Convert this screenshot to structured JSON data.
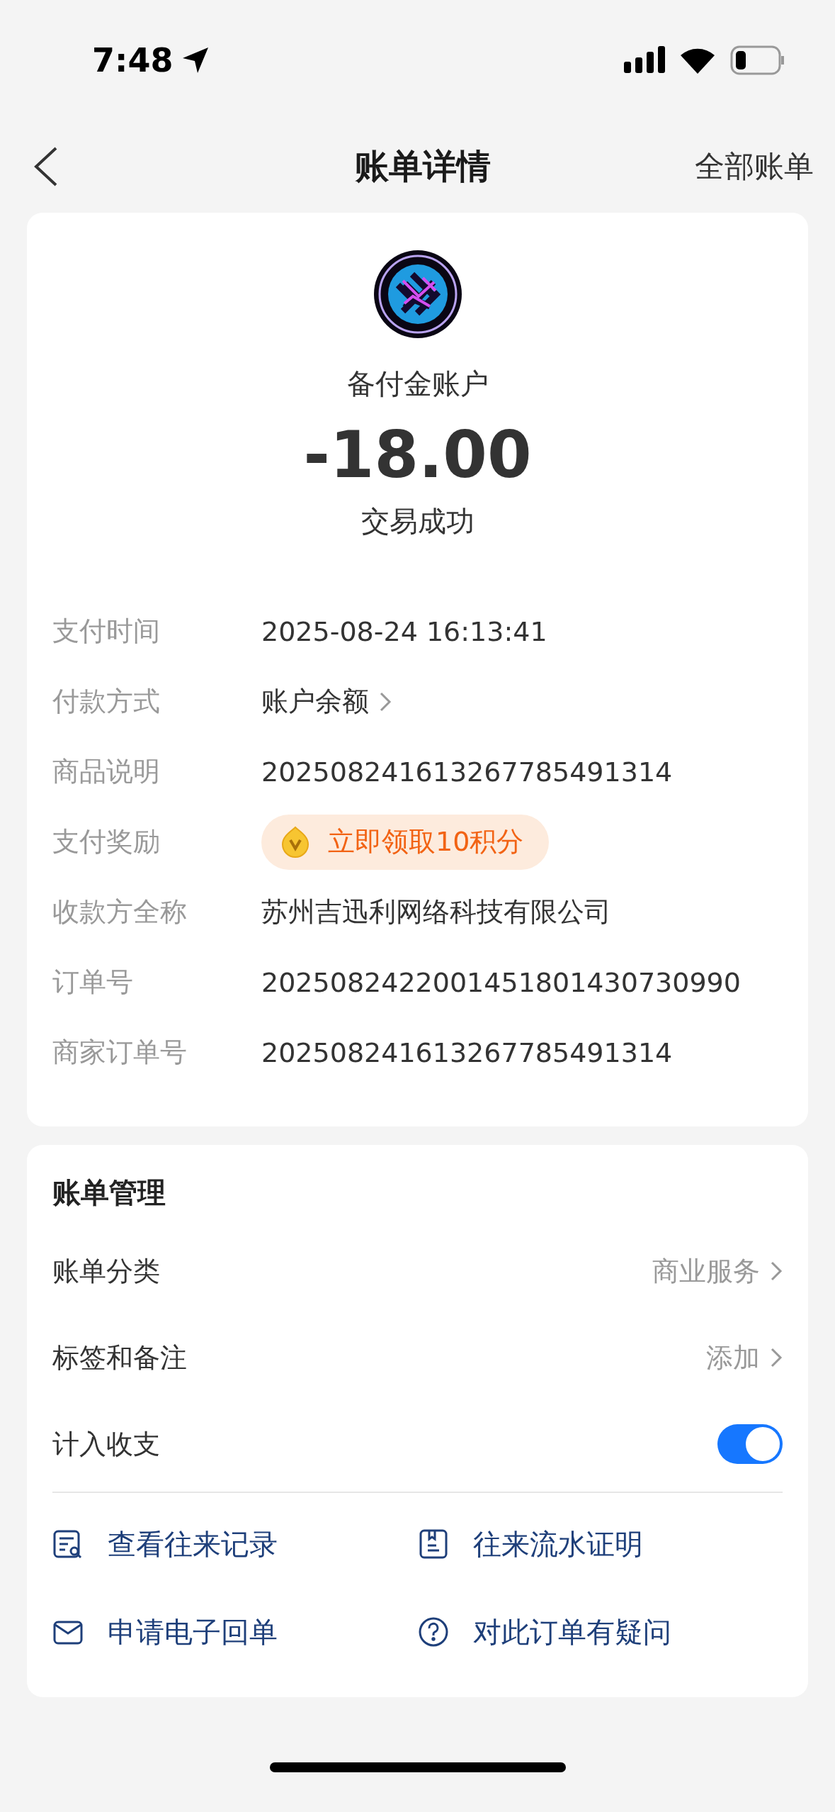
{
  "status_bar": {
    "time": "7:48"
  },
  "nav": {
    "title": "账单详情",
    "action": "全部账单"
  },
  "summary": {
    "account": "备付金账户",
    "amount": "-18.00",
    "status": "交易成功"
  },
  "details": [
    {
      "kind": "text",
      "label": "支付时间",
      "value": "2025-08-24 16:13:41"
    },
    {
      "kind": "link",
      "label": "付款方式",
      "value": "账户余额"
    },
    {
      "kind": "text",
      "label": "商品说明",
      "value": "202508241613267785491314"
    },
    {
      "kind": "reward",
      "label": "支付奖励",
      "value": "立即领取10积分"
    },
    {
      "kind": "text",
      "label": "收款方全称",
      "value": "苏州吉迅利网络科技有限公司"
    },
    {
      "kind": "text",
      "label": "订单号",
      "value": "2025082422001451801430730990"
    },
    {
      "kind": "text",
      "label": "商家订单号",
      "value": "202508241613267785491314"
    }
  ],
  "management": {
    "title": "账单管理",
    "rows": [
      {
        "kind": "link",
        "label": "账单分类",
        "value": "商业服务"
      },
      {
        "kind": "link",
        "label": "标签和备注",
        "value": "添加"
      },
      {
        "kind": "toggle",
        "label": "计入收支",
        "on": true
      }
    ],
    "actions": [
      "查看往来记录",
      "往来流水证明",
      "申请电子回单",
      "对此订单有疑问"
    ]
  }
}
